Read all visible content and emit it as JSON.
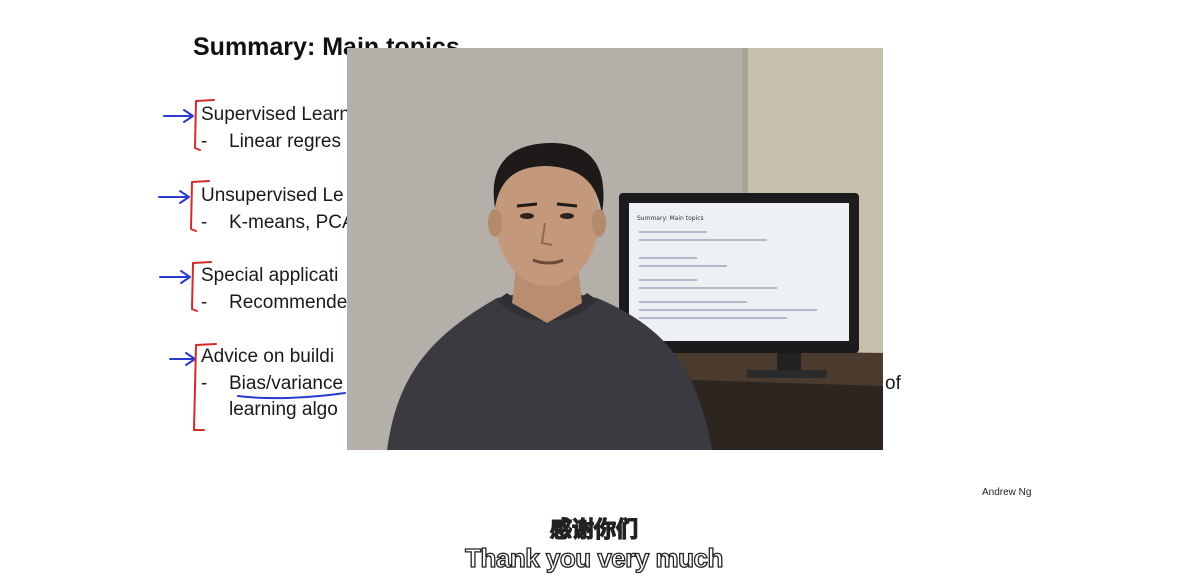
{
  "slide": {
    "title": "Summary: Main topics",
    "sections": [
      {
        "heading": "Supervised Learn",
        "sub": "Linear regres"
      },
      {
        "heading": "Unsupervised Le",
        "sub": "K-means, PCA"
      },
      {
        "heading": "Special applicati",
        "sub": "Recommende"
      },
      {
        "heading": "Advice on buildi",
        "sub": "Bias/variance",
        "sub2": "learning algo",
        "trailing": "of"
      }
    ],
    "dash": "-",
    "credit": "Andrew Ng"
  },
  "annotation_colors": {
    "arrow": "#2a3bd0",
    "bracket": "#d42a2a"
  },
  "video": {
    "icon": "presenter-video",
    "monitor_title": "Summary: Main topics"
  },
  "subtitles": {
    "chinese": "感谢你们",
    "english": "Thank you very much"
  }
}
